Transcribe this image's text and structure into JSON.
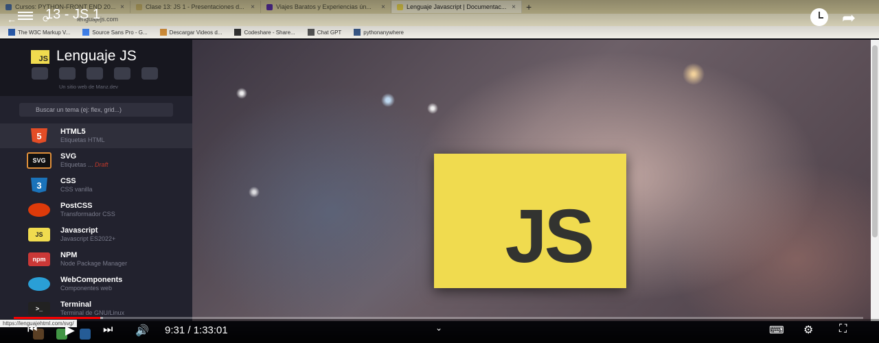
{
  "browser": {
    "tabs": [
      {
        "label": "Cursos: PYTHON-FRONT END 20...",
        "favicon_color": "#4b6fa5"
      },
      {
        "label": "Clase 13: JS 1 - Presentaciones d...",
        "favicon_color": "#c9b46a"
      },
      {
        "label": "Viajes Baratos y Experiencias ún...",
        "favicon_color": "#5a2ea6"
      },
      {
        "label": "Lenguaje Javascript | Documentac...",
        "favicon_color": "#f0db4f",
        "active": true
      }
    ],
    "address": "lenguajejs.com",
    "bookmarks": [
      {
        "label": "The W3C Markup V...",
        "icon_color": "#2a5db0"
      },
      {
        "label": "Source Sans Pro - G...",
        "icon_color": "#4285f4"
      },
      {
        "label": "Descargar Videos d...",
        "icon_color": "#d6913a"
      },
      {
        "label": "Codeshare - Share...",
        "icon_color": "#333333"
      },
      {
        "label": "Chat GPT",
        "icon_color": "#555555"
      },
      {
        "label": "pythonanywhere",
        "icon_color": "#3a5a8a"
      }
    ],
    "status_url": "https://lenguajehtml.com/svg/"
  },
  "player": {
    "title": "13 - JS 1",
    "time": "9:31 / 1:33:01",
    "progress_fraction": 0.102,
    "buffer_fraction": 0.105
  },
  "site": {
    "title": "Lenguaje JS",
    "logo_text": "JS",
    "tagline": "Un sitio web de Manz.dev",
    "search_placeholder": "Buscar un tema (ej: flex, grid...)",
    "items": [
      {
        "name": "HTML5",
        "sub": "Etiquetas HTML",
        "icon": "html5-icon",
        "icon_text": "5",
        "color": "#e44d26",
        "highlight": true
      },
      {
        "name": "SVG",
        "sub": "Etiquetas ...",
        "draft": "Draft",
        "icon": "svg-icon",
        "icon_text": "SVG",
        "color": "#e0903a"
      },
      {
        "name": "CSS",
        "sub": "CSS vanilla",
        "icon": "css3-icon",
        "icon_text": "3",
        "color": "#1b73ba"
      },
      {
        "name": "PostCSS",
        "sub": "Transformador CSS",
        "icon": "postcss-icon",
        "icon_text": "",
        "color": "#dd3a0a"
      },
      {
        "name": "Javascript",
        "sub": "Javascript ES2022+",
        "icon": "javascript-icon",
        "icon_text": "JS",
        "color": "#f0db4f"
      },
      {
        "name": "NPM",
        "sub": "Node Package Manager",
        "icon": "npm-icon",
        "icon_text": "npm",
        "color": "#cb3837"
      },
      {
        "name": "WebComponents",
        "sub": "Componentes web",
        "icon": "webcomponents-icon",
        "icon_text": "",
        "color": "#2a9fd6"
      },
      {
        "name": "Terminal",
        "sub": "Terminal de GNU/Linux",
        "icon": "terminal-icon",
        "icon_text": ">_",
        "color": "#222222"
      }
    ]
  },
  "hero": {
    "logo_text": "JS"
  },
  "colors": {
    "js_yellow": "#f0db4f",
    "accent_red": "#ff0000"
  }
}
